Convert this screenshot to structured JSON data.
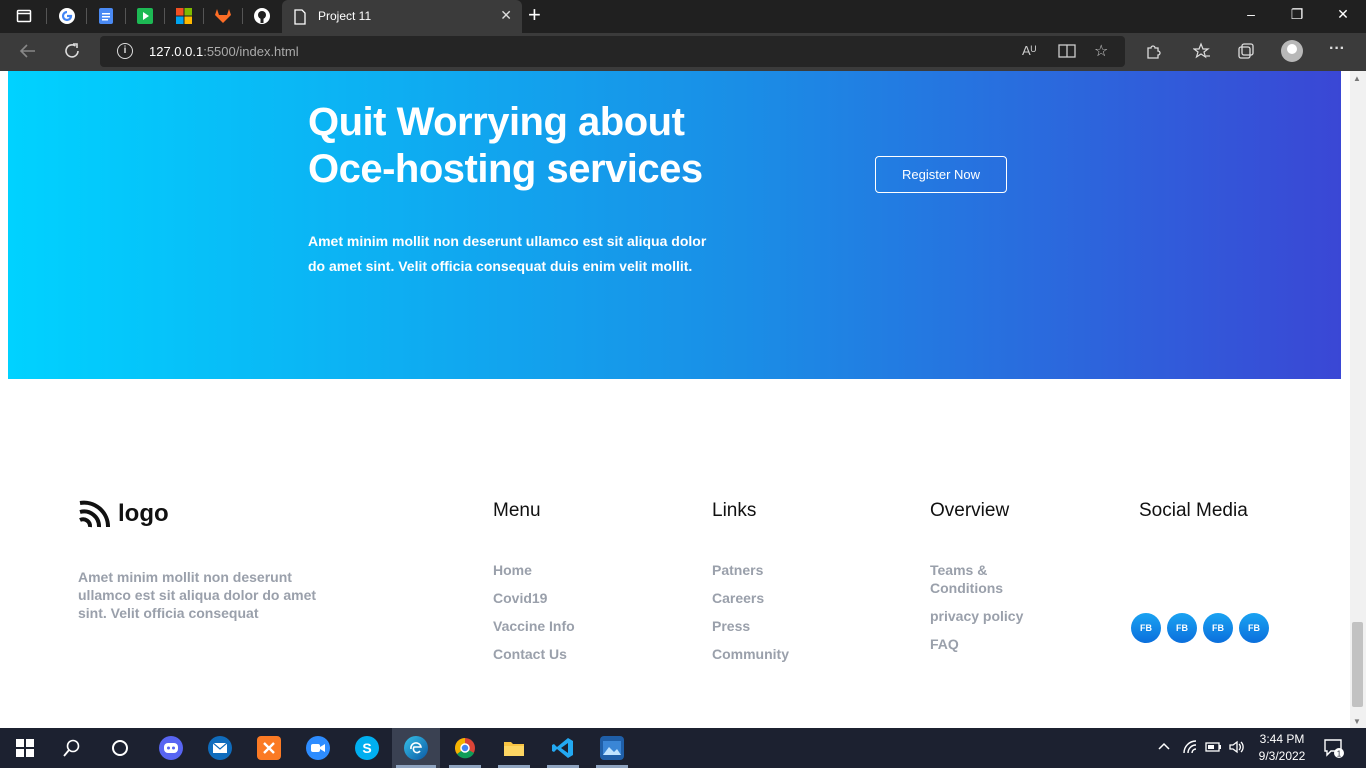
{
  "browser": {
    "tab_title": "Project 11",
    "tab_close": "✕",
    "new_tab": "+",
    "url_host": "127.0.0.1",
    "url_rest": ":5500/index.html",
    "window_controls": [
      "–",
      "❐",
      "✕"
    ],
    "omnibox_tools": [
      "Aᵁ",
      "▯",
      "☆"
    ],
    "toolbar_icons": [
      "puzzle-icon",
      "favorites-icon",
      "collections-icon",
      "profile-icon",
      "menu-icon"
    ],
    "menu_glyph": "···"
  },
  "hero": {
    "title": "Quit Worrying about Oce-hosting services",
    "description": "Amet minim mollit non deserunt ullamco est sit aliqua dolor do amet sint. Velit officia consequat duis enim velit mollit.",
    "cta_label": "Register Now",
    "gradient_start": "#00d2ff",
    "gradient_end": "#3a47d5"
  },
  "footer": {
    "logo_text": "logo",
    "description": "Amet minim mollit non deserunt ullamco est sit aliqua dolor do amet sint. Velit officia consequat",
    "menu": {
      "title": "Menu",
      "items": [
        "Home",
        "Covid19",
        "Vaccine Info",
        "Contact Us"
      ]
    },
    "links": {
      "title": "Links",
      "items": [
        "Patners",
        "Careers",
        "Press",
        "Community"
      ]
    },
    "overview": {
      "title": "Overview",
      "items": [
        "Teams & Conditions",
        "privacy policy",
        "FAQ"
      ]
    },
    "social": {
      "title": "Social Media",
      "buttons": [
        "FB",
        "FB",
        "FB",
        "FB"
      ]
    }
  },
  "taskbar": {
    "time": "3:44 PM",
    "date": "9/3/2022",
    "notification_count": "1"
  }
}
